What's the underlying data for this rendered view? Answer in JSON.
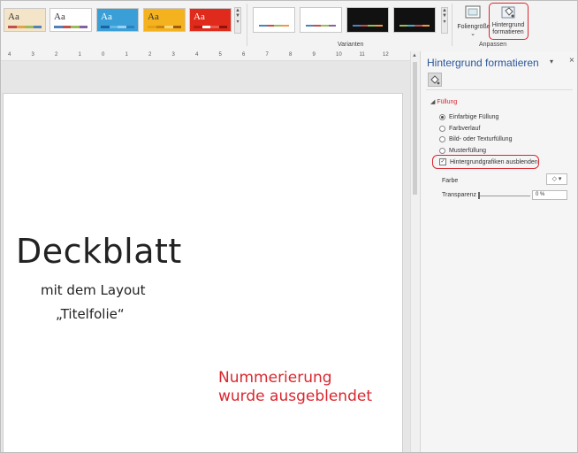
{
  "ribbon": {
    "themes": [
      {
        "label": "Aa",
        "bg": "#f4e4c8",
        "fg": "#333333",
        "colors": [
          "#c0504d",
          "#e3a34a",
          "#9bbb59",
          "#4f81bd"
        ]
      },
      {
        "label": "Aa",
        "bg": "#ffffff",
        "fg": "#333333",
        "colors": [
          "#4f81bd",
          "#c0504d",
          "#9bbb59",
          "#8064a2"
        ]
      },
      {
        "label": "Aa",
        "bg": "#3a9fd6",
        "fg": "#ffffff",
        "colors": [
          "#1f5fa3",
          "#5fb8e8",
          "#9ad0f0",
          "#2c7fc0"
        ]
      },
      {
        "label": "Aa",
        "bg": "#f5b21f",
        "fg": "#333333",
        "colors": [
          "#e6a016",
          "#c88312",
          "#f5d57a",
          "#a05a10"
        ]
      },
      {
        "label": "Aa",
        "bg": "#e02a1b",
        "fg": "#ffffff",
        "colors": [
          "#b81d10",
          "#ffffff",
          "#e85b4e",
          "#8a150b"
        ]
      }
    ],
    "variants": [
      {
        "bg": "#ffffff",
        "colors": [
          "#4f81bd",
          "#c0504d",
          "#9bbb59",
          "#f79646"
        ]
      },
      {
        "bg": "#ffffff",
        "colors": [
          "#4f81bd",
          "#c0504d",
          "#9bbb59",
          "#8064a2"
        ]
      },
      {
        "bg": "#111111",
        "colors": [
          "#4f81bd",
          "#c0504d",
          "#9bbb59",
          "#f79646"
        ]
      },
      {
        "bg": "#111111",
        "colors": [
          "#9bbb59",
          "#4bacc6",
          "#c0504d",
          "#f79646"
        ]
      }
    ],
    "group_variants": "Varianten",
    "group_anpassen": "Anpassen",
    "slide_size_label": "Foliengröße",
    "bg_format_label_1": "Hintergrund",
    "bg_format_label_2": "formatieren"
  },
  "ruler_ticks": [
    "4",
    "3",
    "2",
    "1",
    "0",
    "1",
    "2",
    "3",
    "4",
    "5",
    "6",
    "7",
    "8",
    "9",
    "10",
    "11",
    "12"
  ],
  "slide": {
    "title": "Deckblatt",
    "subtitle_1": "mit dem Layout",
    "subtitle_2": "„Titelfolie“",
    "annotation_1": "Nummerierung",
    "annotation_2": "wurde ausgeblendet"
  },
  "pane": {
    "title": "Hintergrund formatieren",
    "section": "Füllung",
    "options": [
      "Einfarbige Füllung",
      "Farbverlauf",
      "Bild- oder Texturfüllung",
      "Musterfüllung"
    ],
    "selected_option": "Einfarbige Füllung",
    "hide_graphics": "Hintergrundgrafiken ausblenden",
    "hide_graphics_checked": true,
    "color_label": "Farbe",
    "transparency_label": "Transparenz",
    "transparency_value": "0 %"
  },
  "colors": {
    "highlight": "#d9262e",
    "annotation": "#d9262e",
    "pane_title": "#2b579a"
  }
}
